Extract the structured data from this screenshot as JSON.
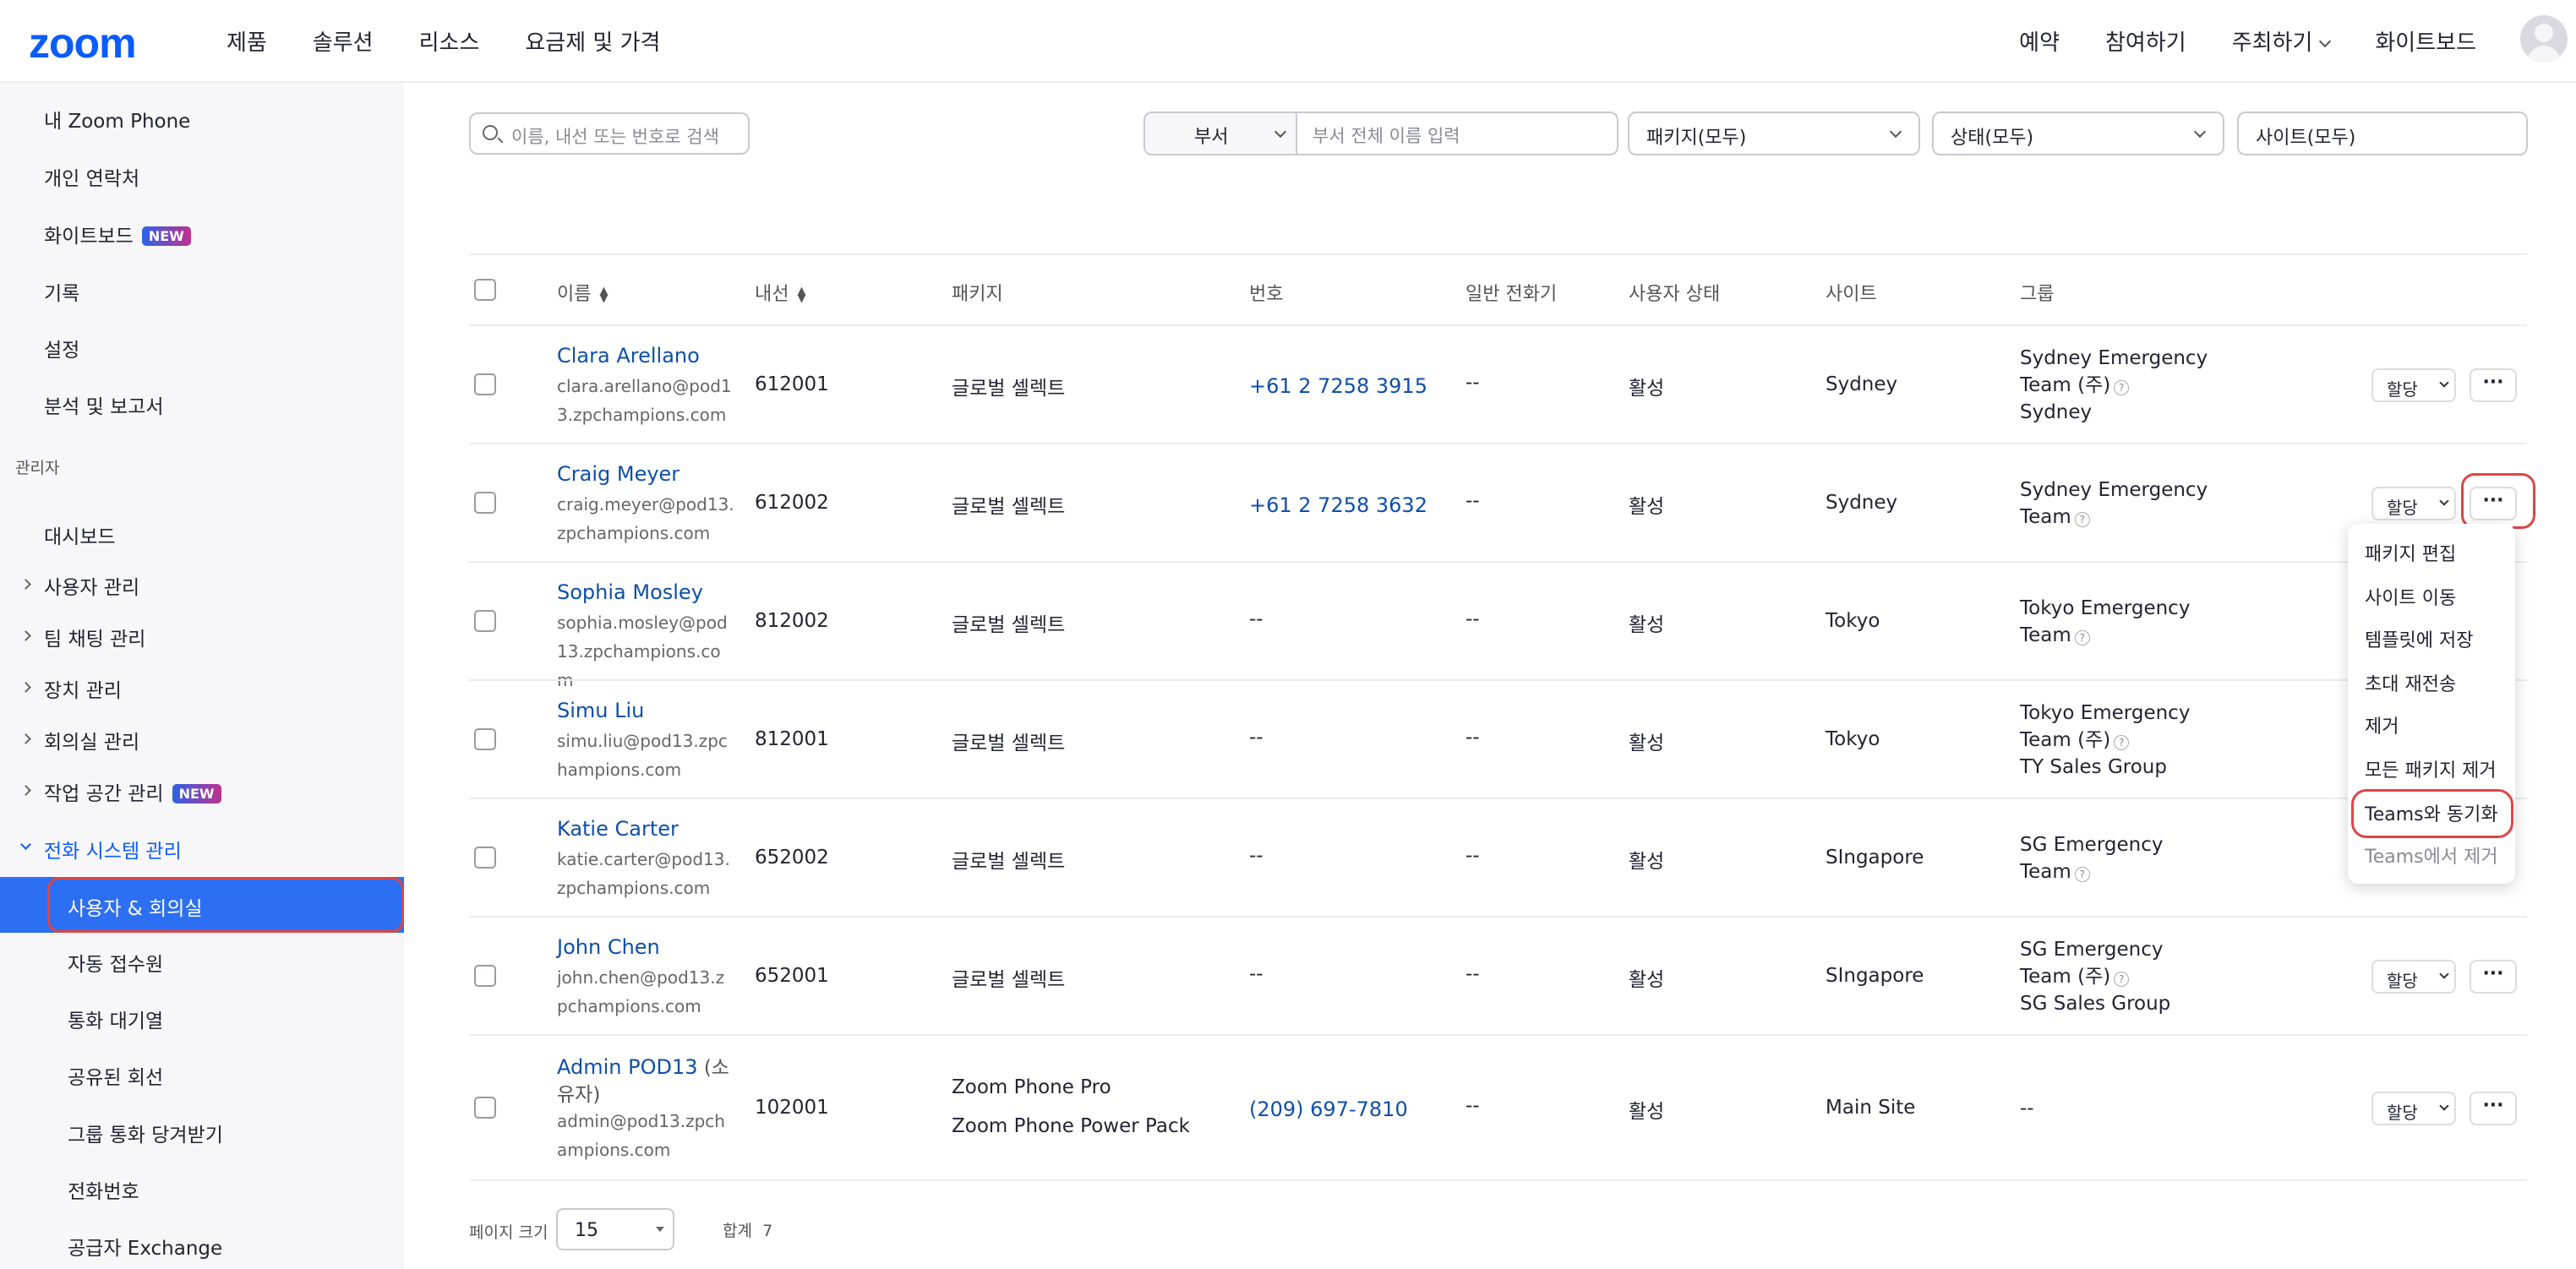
{
  "topnav": {
    "logo": "zoom",
    "left": [
      "제품",
      "솔루션",
      "리소스",
      "요금제 및 가격"
    ],
    "right": [
      "예약",
      "참여하기",
      "주최하기",
      "화이트보드"
    ]
  },
  "sidebar": {
    "top_items": [
      "내 Zoom Phone",
      "개인 연락처",
      "화이트보드",
      "기록",
      "설정",
      "분석 및 보고서"
    ],
    "whiteboard_badge": "NEW",
    "admin_section": "관리자",
    "dashboard": "대시보드",
    "collapsible": [
      "사용자 관리",
      "팀 채팅 관리",
      "장치 관리",
      "회의실 관리",
      "작업 공간 관리"
    ],
    "workspace_badge": "NEW",
    "phone_system": "전화 시스템 관리",
    "sub_items": [
      "사용자 & 회의실",
      "자동 접수원",
      "통화 대기열",
      "공유된 회선",
      "그룹 통화 당겨받기",
      "전화번호",
      "공급자 Exchange"
    ]
  },
  "filters": {
    "search_placeholder": "이름, 내선 또는 번호로 검색",
    "dept_label": "부서",
    "dept_placeholder": "부서 전체 이름 입력",
    "package": "패키지(모두)",
    "status": "상태(모두)",
    "site": "사이트(모두)"
  },
  "table": {
    "headers": [
      "이름",
      "내선",
      "패키지",
      "번호",
      "일반 전화기",
      "사용자 상태",
      "사이트",
      "그룹"
    ],
    "assign_label": "할당",
    "more_label": "···",
    "rows": [
      {
        "name": "Clara Arellano",
        "email": "clara.arellano@pod13.zpchampions.com",
        "ext": "612001",
        "pkg": [
          "글로벌 셀렉트"
        ],
        "num": "+61 2 7258 3915",
        "desk": "--",
        "status": "활성",
        "site": "Sydney",
        "group": [
          "Sydney Emergency",
          "Team (주)",
          "Sydney"
        ]
      },
      {
        "name": "Craig Meyer",
        "email": "craig.meyer@pod13.zpchampions.com",
        "ext": "612002",
        "pkg": [
          "글로벌 셀렉트"
        ],
        "num": "+61 2 7258 3632",
        "desk": "--",
        "status": "활성",
        "site": "Sydney",
        "group": [
          "Sydney Emergency",
          "Team"
        ]
      },
      {
        "name": "Sophia Mosley",
        "email": "sophia.mosley@pod13.zpchampions.com",
        "ext": "812002",
        "pkg": [
          "글로벌 셀렉트"
        ],
        "num": "--",
        "desk": "--",
        "status": "활성",
        "site": "Tokyo",
        "group": [
          "Tokyo Emergency",
          "Team"
        ]
      },
      {
        "name": "Simu Liu",
        "email": "simu.liu@pod13.zpchampions.com",
        "ext": "812001",
        "pkg": [
          "글로벌 셀렉트"
        ],
        "num": "--",
        "desk": "--",
        "status": "활성",
        "site": "Tokyo",
        "group": [
          "Tokyo Emergency",
          "Team (주)",
          "TY Sales Group"
        ]
      },
      {
        "name": "Katie Carter",
        "email": "katie.carter@pod13.zpchampions.com",
        "ext": "652002",
        "pkg": [
          "글로벌 셀렉트"
        ],
        "num": "--",
        "desk": "--",
        "status": "활성",
        "site": "SIngapore",
        "group": [
          "SG Emergency",
          "Team"
        ]
      },
      {
        "name": "John Chen",
        "email": "john.chen@pod13.zpchampions.com",
        "ext": "652001",
        "pkg": [
          "글로벌 셀렉트"
        ],
        "num": "--",
        "desk": "--",
        "status": "활성",
        "site": "SIngapore",
        "group": [
          "SG Emergency",
          "Team (주)",
          "SG Sales Group"
        ]
      },
      {
        "name": "Admin POD13",
        "name_suffix": "(소유자)",
        "email": "admin@pod13.zpchampions.com",
        "ext": "102001",
        "pkg": [
          "Zoom Phone Pro",
          "Zoom Phone Power Pack"
        ],
        "num": "(209) 697-7810",
        "desk": "--",
        "status": "활성",
        "site": "Main Site",
        "group": [
          "--"
        ]
      }
    ]
  },
  "context_menu": [
    "패키지 편집",
    "사이트 이동",
    "템플릿에 저장",
    "초대 재전송",
    "제거",
    "모든 패키지 제거",
    "Teams와 동기화",
    "Teams에서 제거"
  ],
  "footer": {
    "page_size_label": "페이지 크기",
    "page_size": "15",
    "total_label": "합계",
    "total": "7"
  },
  "colors": {
    "brand": "#0b5cff",
    "active": "#2d6ff2",
    "highlight": "#e04545",
    "link": "#0e4fa8"
  }
}
